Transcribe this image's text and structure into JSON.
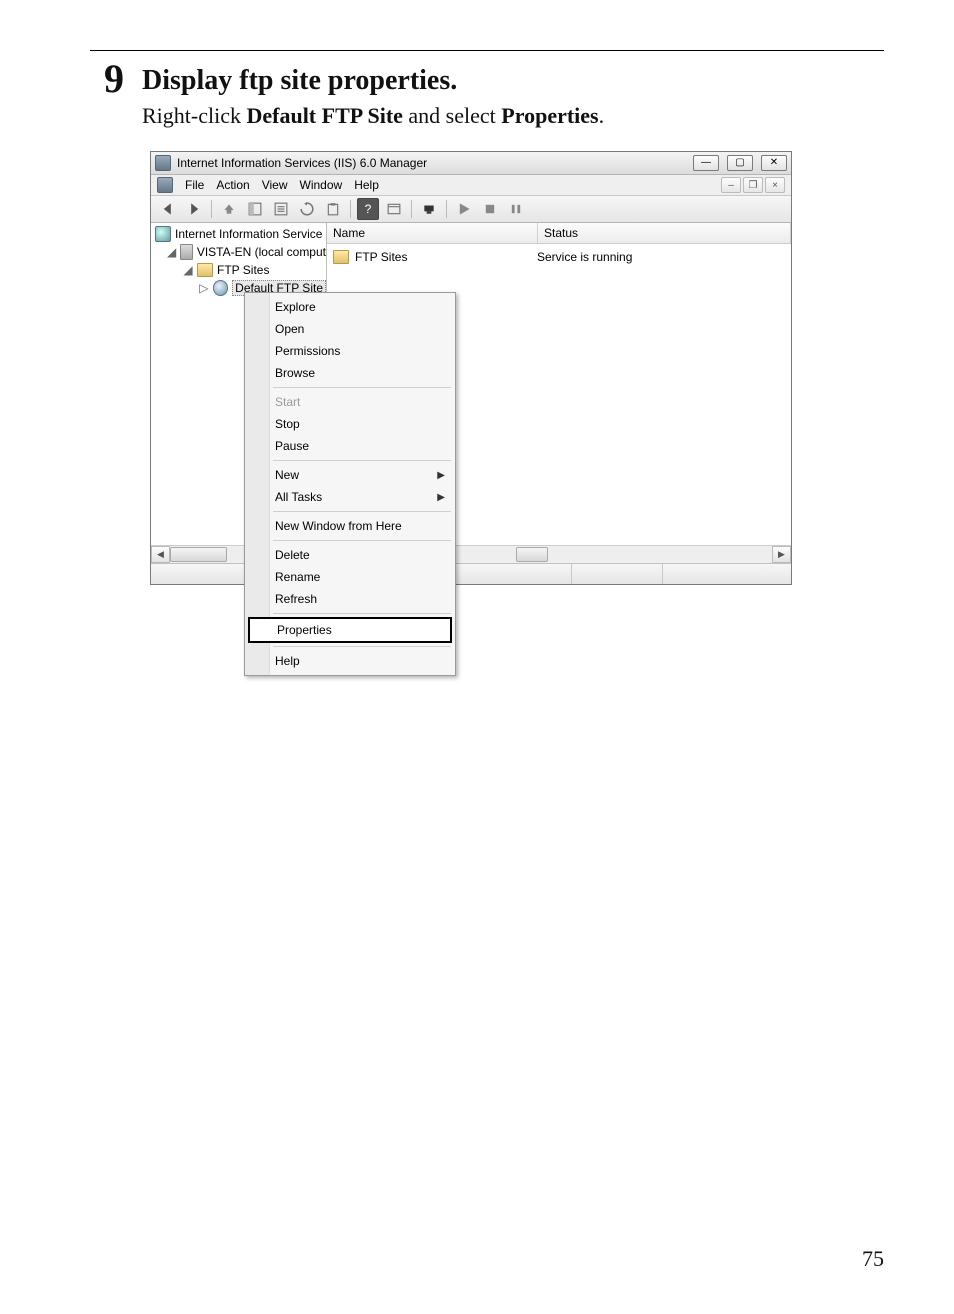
{
  "step": {
    "number": "9",
    "title": "Display ftp site properties.",
    "sub_pre": "Right-click ",
    "sub_b1": "Default FTP Site",
    "sub_mid": " and select ",
    "sub_b2": "Properties",
    "sub_suf": "."
  },
  "window": {
    "title": "Internet Information Services (IIS) 6.0 Manager"
  },
  "menus": {
    "file": "File",
    "action": "Action",
    "view": "View",
    "window": "Window",
    "help": "Help"
  },
  "tree": {
    "root": "Internet Information Service",
    "server": "VISTA-EN (local comput",
    "folder": "FTP Sites",
    "site": "Default FTP Site"
  },
  "list": {
    "hdr_name": "Name",
    "hdr_status": "Status",
    "row_name": "FTP Sites",
    "row_status": "Service is running"
  },
  "ctx": {
    "explore": "Explore",
    "open": "Open",
    "permissions": "Permissions",
    "browse": "Browse",
    "start": "Start",
    "stop": "Stop",
    "pause": "Pause",
    "new": "New",
    "alltasks": "All Tasks",
    "newwin": "New Window from Here",
    "delete": "Delete",
    "rename": "Rename",
    "refresh": "Refresh",
    "properties": "Properties",
    "help": "Help"
  },
  "page_number": "75"
}
